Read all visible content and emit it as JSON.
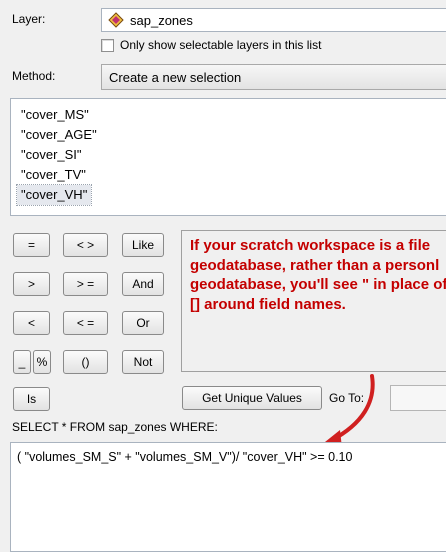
{
  "layer": {
    "label": "Layer:",
    "value": "sap_zones",
    "only_selectable_label": "Only show selectable layers in this list"
  },
  "method": {
    "label": "Method:",
    "value": "Create a new selection"
  },
  "fields": [
    "\"cover_MS\"",
    "\"cover_AGE\"",
    "\"cover_SI\"",
    "\"cover_TV\"",
    "\"cover_VH\""
  ],
  "operators": {
    "eq": "=",
    "neq": "< >",
    "like": "Like",
    "gt": ">",
    "gte": "> =",
    "and": "And",
    "lt": "<",
    "lte": "< =",
    "or": "Or",
    "underscore": "_",
    "percent": "%",
    "parens": "()",
    "not": "Not",
    "is": "Is"
  },
  "note": "If your scratch workspace is a file geodatabase, rather than a personl geodatabase, you'll see \" in place of [] around field names.",
  "unique_values_button": "Get Unique Values",
  "goto_label": "Go To:",
  "sql": {
    "label": "SELECT * FROM sap_zones WHERE:",
    "expression": "( \"volumes_SM_S\" + \"volumes_SM_V\")/ \"cover_VH\" >= 0.10"
  },
  "colors": {
    "note_text": "#c40000",
    "arrow": "#d02020"
  }
}
